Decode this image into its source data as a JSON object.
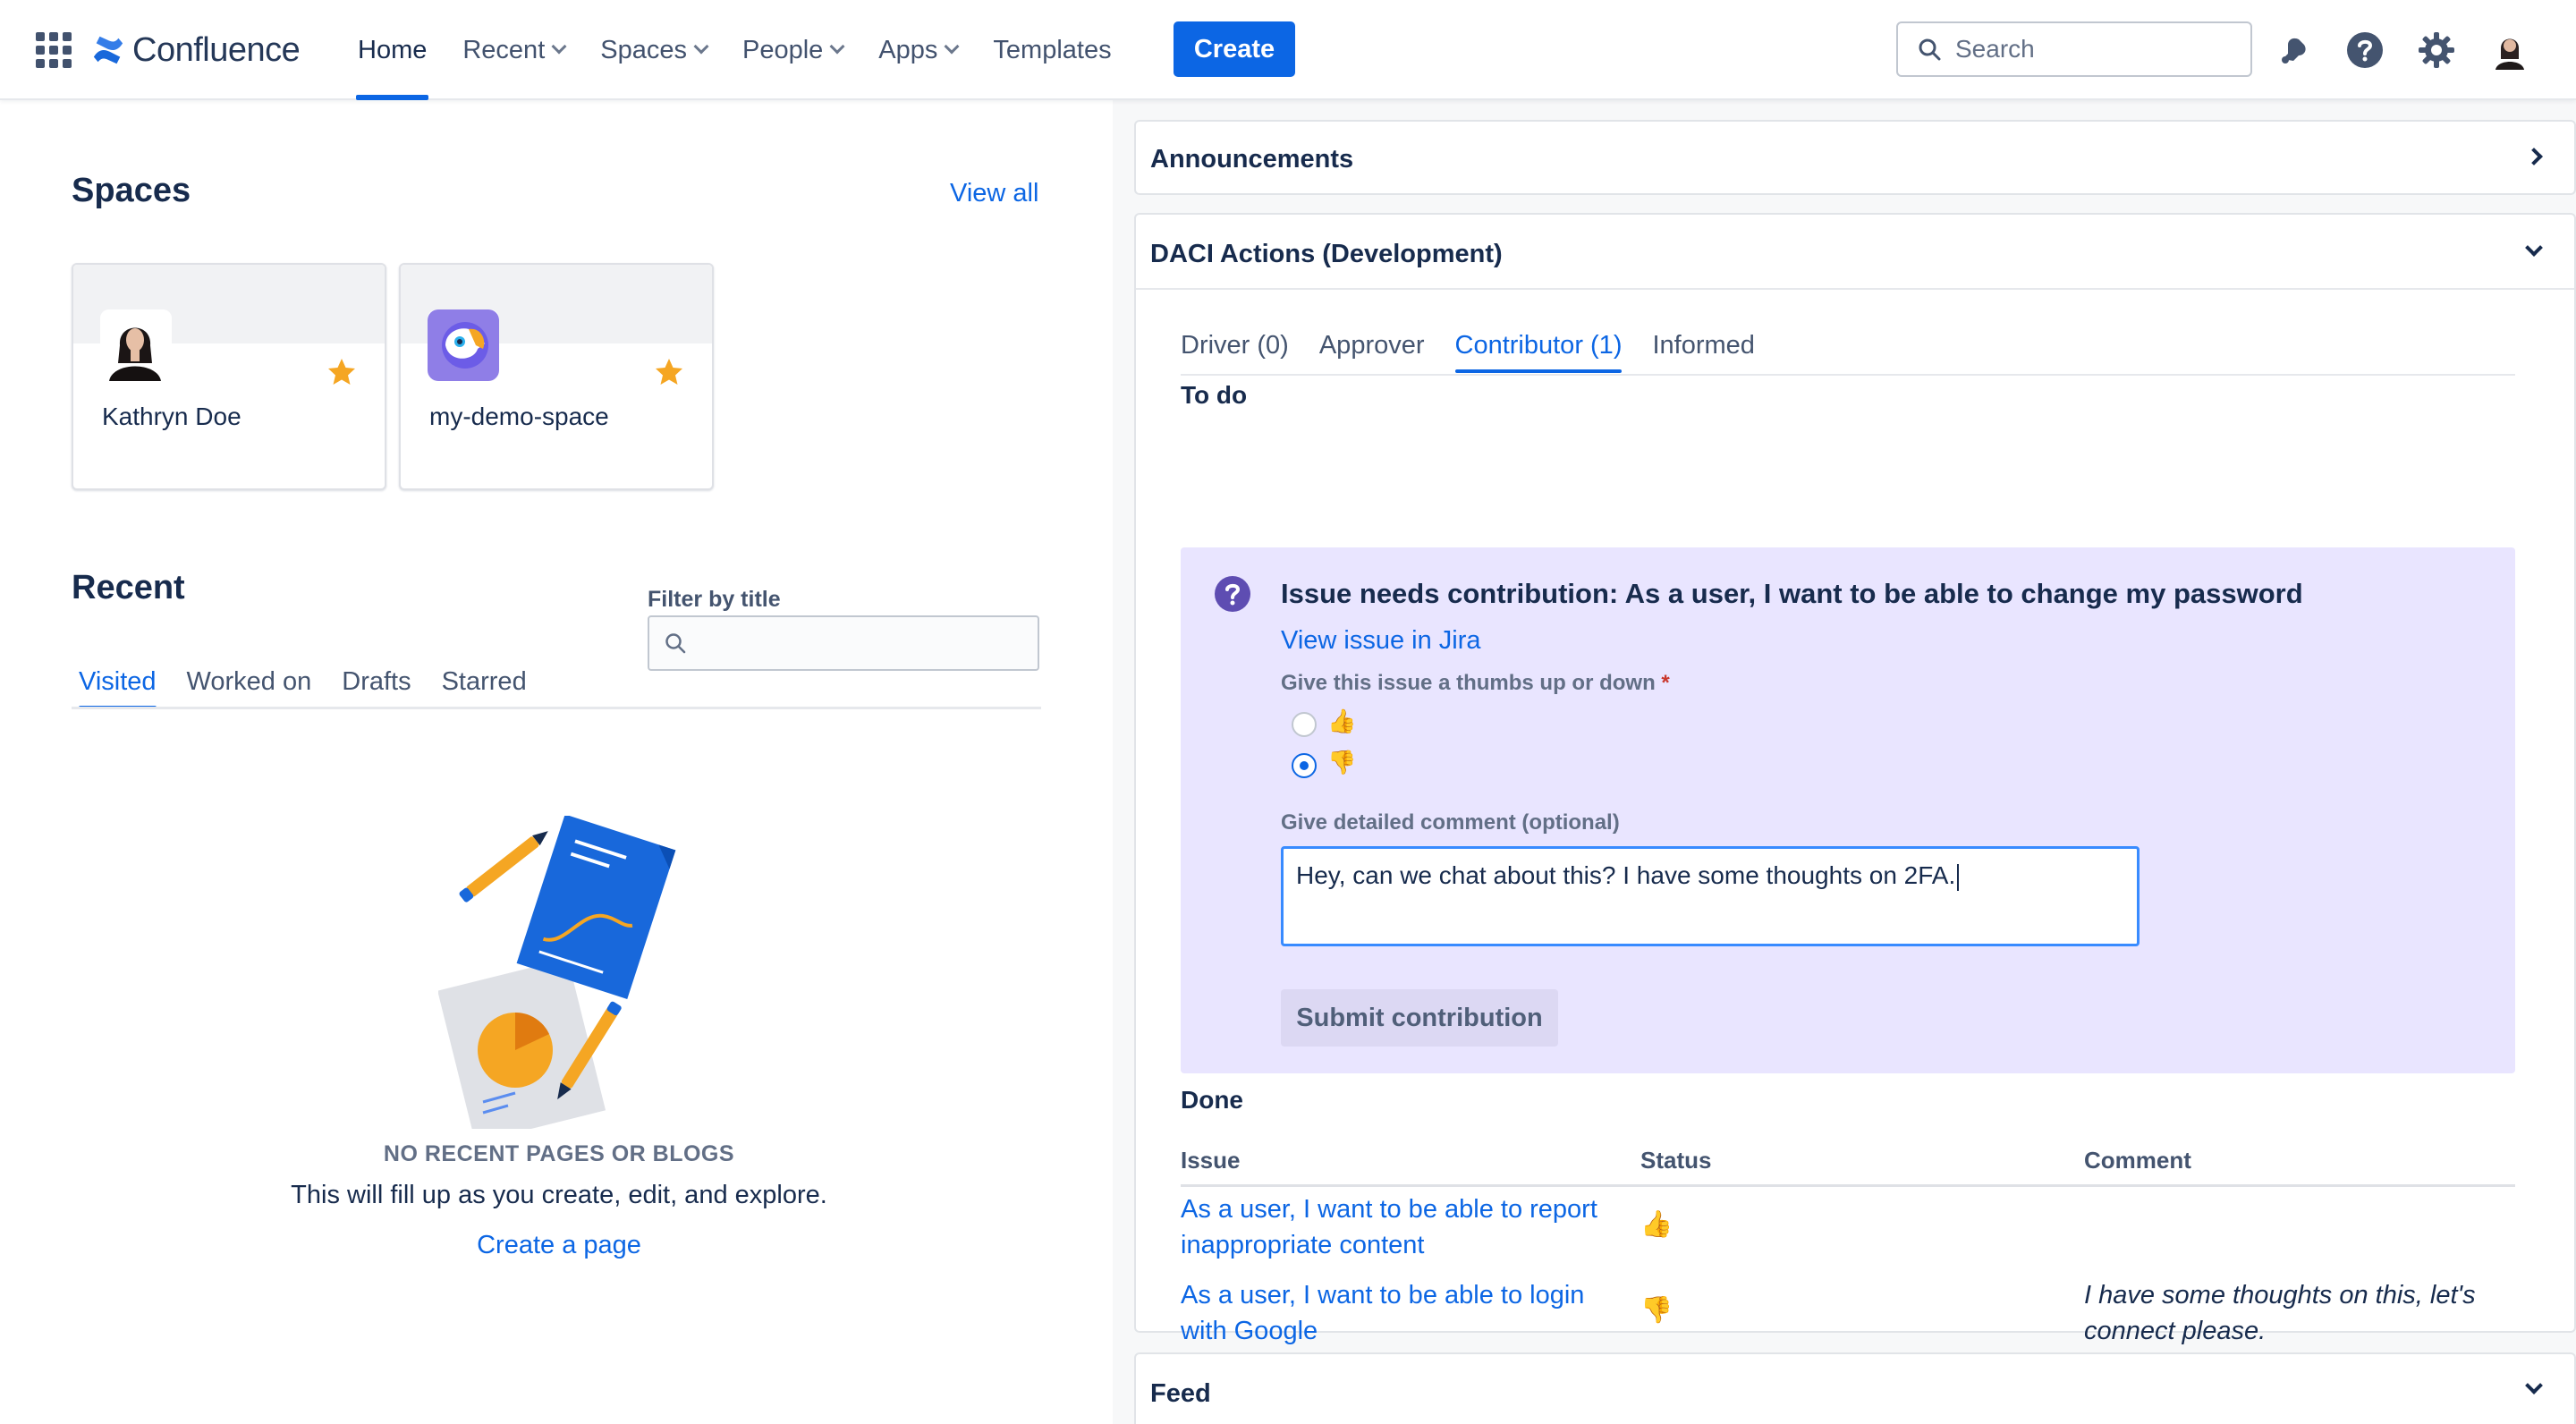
{
  "topnav": {
    "brand": "Confluence",
    "items": [
      {
        "label": "Home",
        "active": true,
        "dropdown": false
      },
      {
        "label": "Recent",
        "active": false,
        "dropdown": true
      },
      {
        "label": "Spaces",
        "active": false,
        "dropdown": true
      },
      {
        "label": "People",
        "active": false,
        "dropdown": true
      },
      {
        "label": "Apps",
        "active": false,
        "dropdown": true
      },
      {
        "label": "Templates",
        "active": false,
        "dropdown": false
      }
    ],
    "create_label": "Create",
    "search_placeholder": "Search",
    "icons": [
      "notifications-icon",
      "help-icon",
      "settings-icon",
      "profile-avatar"
    ]
  },
  "spaces": {
    "title": "Spaces",
    "view_all": "View all",
    "cards": [
      {
        "name": "Kathryn Doe",
        "starred": true
      },
      {
        "name": "my-demo-space",
        "starred": true
      }
    ]
  },
  "recent": {
    "title": "Recent",
    "filter_label": "Filter by title",
    "tabs": [
      "Visited",
      "Worked on",
      "Drafts",
      "Starred"
    ],
    "active_tab": "Visited",
    "empty_heading": "NO RECENT PAGES OR BLOGS",
    "empty_text": "This will fill up as you create, edit, and explore.",
    "create_link": "Create a page"
  },
  "announcements": {
    "title": "Announcements"
  },
  "daci": {
    "title": "DACI Actions (Development)",
    "tabs": [
      "Driver (0)",
      "Approver",
      "Contributor (1)",
      "Informed"
    ],
    "active_tab": "Contributor (1)",
    "todo_label": "To do",
    "issue_title": "Issue needs contribution: As a user, I want to be able to change my password",
    "view_issue": "View issue in Jira",
    "thumbs_label": "Give this issue a thumbs up or down",
    "required_mark": "*",
    "thumbs_up": "👍",
    "thumbs_down": "👎",
    "selected": "down",
    "comment_label": "Give detailed comment (optional)",
    "comment_value": "Hey, can we chat about this? I have some thoughts on 2FA.",
    "submit_label": "Submit contribution",
    "done_label": "Done",
    "columns": [
      "Issue",
      "Status",
      "Comment"
    ],
    "rows": [
      {
        "issue_line1": "As a user, I want to be able to report",
        "issue_line2": "inappropriate content",
        "status": "👍",
        "comment_line1": "",
        "comment_line2": ""
      },
      {
        "issue_line1": "As a user, I want to be able to login",
        "issue_line2": "with Google",
        "status": "👎",
        "comment_line1": "I have some thoughts on this, let's",
        "comment_line2": "connect please."
      }
    ]
  },
  "feed": {
    "title": "Feed"
  },
  "colors": {
    "accent": "#0c66e4",
    "panel_bg": "#e9e5ff",
    "star": "#f5a623"
  }
}
